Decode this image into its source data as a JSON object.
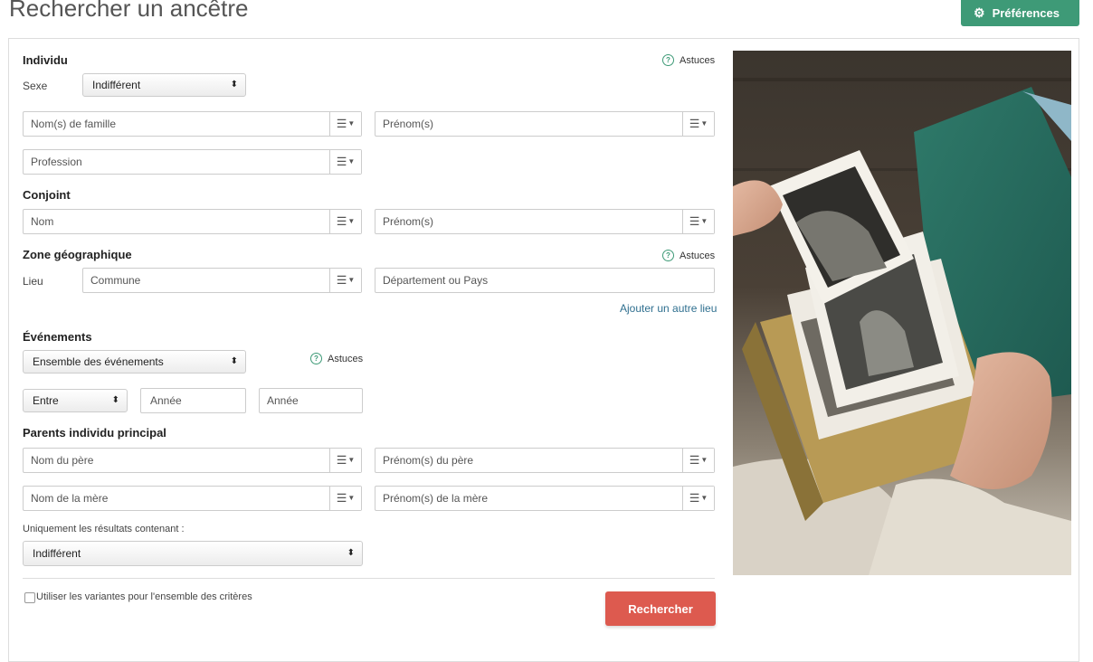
{
  "header": {
    "title": "Rechercher un ancêtre",
    "preferences_label": "Préférences",
    "preferences_icon": "gear-icon",
    "accent_color": "#3e9a77"
  },
  "individu": {
    "heading": "Individu",
    "tips_label": "Astuces",
    "sexe_label": "Sexe",
    "sexe_value": "Indifférent",
    "nom_placeholder": "Nom(s) de famille",
    "prenom_placeholder": "Prénom(s)",
    "profession_placeholder": "Profession"
  },
  "conjoint": {
    "heading": "Conjoint",
    "nom_placeholder": "Nom",
    "prenom_placeholder": "Prénom(s)"
  },
  "zone": {
    "heading": "Zone géographique",
    "tips_label": "Astuces",
    "lieu_label": "Lieu",
    "commune_placeholder": "Commune",
    "departement_placeholder": "Département ou Pays",
    "add_place_link": "Ajouter un autre lieu"
  },
  "evenements": {
    "heading": "Événements",
    "type_value": "Ensemble des événements",
    "tips_label": "Astuces",
    "range_value": "Entre",
    "annee_from_placeholder": "Année",
    "annee_to_placeholder": "Année"
  },
  "parents": {
    "heading": "Parents individu principal",
    "pere_nom_placeholder": "Nom du père",
    "pere_prenom_placeholder": "Prénom(s) du père",
    "mere_nom_placeholder": "Nom de la mère",
    "mere_prenom_placeholder": "Prénom(s) de la mère"
  },
  "filter": {
    "label": "Uniquement les résultats contenant :",
    "value": "Indifférent"
  },
  "footer": {
    "variants_label": "Utiliser les variantes pour l'ensemble des critères",
    "search_label": "Rechercher",
    "search_color": "#dd5a4f"
  },
  "image": {
    "icon": "old-photographs-image"
  }
}
